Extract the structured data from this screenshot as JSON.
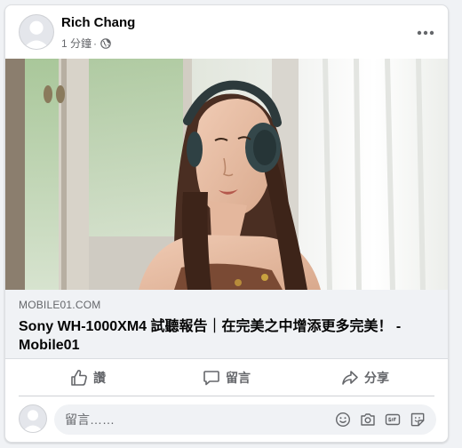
{
  "post": {
    "author": "Rich Chang",
    "time": "1 分鐘",
    "separator": "·",
    "privacy_icon": "globe-icon",
    "more_icon": "more-horizontal-icon"
  },
  "photo": {
    "subject": "woman-wearing-headphones"
  },
  "link_preview": {
    "domain": "MOBILE01.COM",
    "title": "Sony WH-1000XM4 試聽報告｜在完美之中增添更多完美！ - Mobile01"
  },
  "actions": {
    "like_label": "讚",
    "comment_label": "留言",
    "share_label": "分享"
  },
  "comment": {
    "placeholder": "留言……",
    "icons": [
      "emoji-icon",
      "camera-icon",
      "gif-icon",
      "sticker-icon"
    ]
  },
  "colors": {
    "background": "#f0f2f5",
    "card": "#ffffff",
    "secondary_text": "#65676b"
  }
}
